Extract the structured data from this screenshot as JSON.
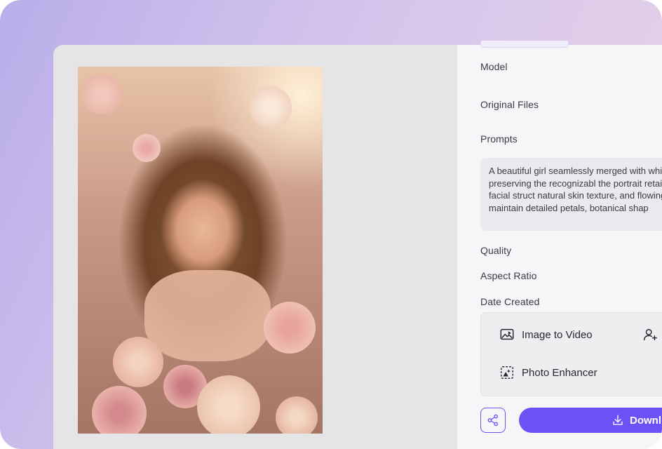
{
  "colors": {
    "accent": "#6b52f5",
    "panel_bg": "#f6f6f8",
    "canvas_bg": "#e5e5e8"
  },
  "image": {
    "alt": "portrait-with-flowers"
  },
  "details": {
    "model_label": "Model",
    "original_files_label": "Original Files",
    "prompts_label": "Prompts",
    "prompt_text": "A beautiful girl seamlessly merged with while clearly preserving the recognizabl the portrait retains realistic facial struct natural skin texture, and flowing hair, wh maintain detailed petals, botanical shap",
    "quality_label": "Quality",
    "aspect_ratio_label": "Aspect Ratio",
    "date_created_label": "Date Created"
  },
  "tools": {
    "image_to_video": "Image to Video",
    "photo_enhancer": "Photo Enhancer"
  },
  "actions": {
    "download_label": "Downl"
  },
  "icons": {
    "image_to_video": "image-video-icon",
    "photo_enhancer": "enhancer-icon",
    "person_add": "person-add-icon",
    "share": "share-icon",
    "download": "download-icon"
  }
}
